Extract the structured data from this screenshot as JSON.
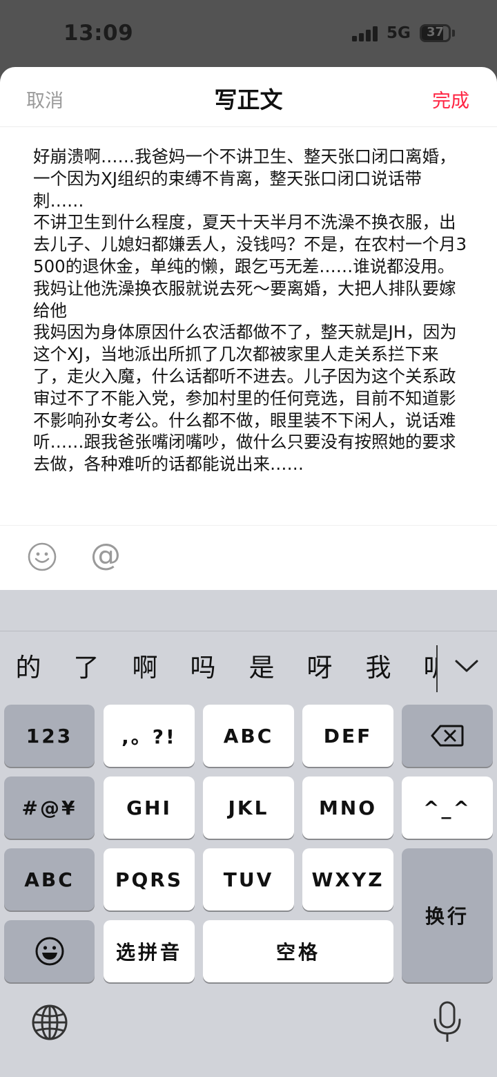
{
  "status_bar": {
    "time": "13:09",
    "network": "5G",
    "battery": "37"
  },
  "nav": {
    "cancel": "取消",
    "title": "写正文",
    "done": "完成"
  },
  "colors": {
    "accent": "#ff2442",
    "cancel": "#9a9a9a"
  },
  "editor": {
    "body": "好崩溃啊……我爸妈一个不讲卫生、整天张口闭口离婚，一个因为XJ组织的束缚不肯离，整天张口闭口说话带刺……\n不讲卫生到什么程度，夏天十天半月不洗澡不换衣服，出去儿子、儿媳妇都嫌丢人，没钱吗？不是，在农村一个月3500的退休金，单纯的懒，跟乞丐无差……谁说都没用。我妈让他洗澡换衣服就说去死～要离婚，大把人排队要嫁给他\n我妈因为身体原因什么农活都做不了，整天就是JH，因为这个XJ，当地派出所抓了几次都被家里人走关系拦下来了，走火入魔，什么话都听不进去。儿子因为这个关系政审过不了不能入党，参加村里的任何竞选，目前不知道影不影响孙女考公。什么都不做，眼里装不下闲人，说话难听……跟我爸张嘴闭嘴吵，做什么只要没有按照她的要求去做，各种难听的话都能说出来……"
  },
  "toolbar": {
    "emoji_icon": "smiley-icon",
    "mention": "@"
  },
  "keyboard": {
    "candidates": [
      "的",
      "了",
      "啊",
      "吗",
      "是",
      "呀",
      "我",
      "听"
    ],
    "rows": [
      [
        "123",
        ",。?!",
        "ABC",
        "DEF",
        "delete"
      ],
      [
        "#@¥",
        "GHI",
        "JKL",
        "MNO",
        "^_^"
      ],
      [
        "ABC",
        "PQRS",
        "TUV",
        "WXYZ",
        "换行"
      ],
      [
        "emoji",
        "选拼音",
        "空格"
      ]
    ],
    "keys": {
      "num": "123",
      "punct": ",。?!",
      "abc": "ABC",
      "def": "DEF",
      "symbols": "#@¥",
      "ghi": "GHI",
      "jkl": "JKL",
      "mno": "MNO",
      "kaomoji": "^_^",
      "abc_switch": "ABC",
      "pqrs": "PQRS",
      "tuv": "TUV",
      "wxyz": "WXYZ",
      "pinyin": "选拼音",
      "space": "空格",
      "return": "换行"
    }
  }
}
